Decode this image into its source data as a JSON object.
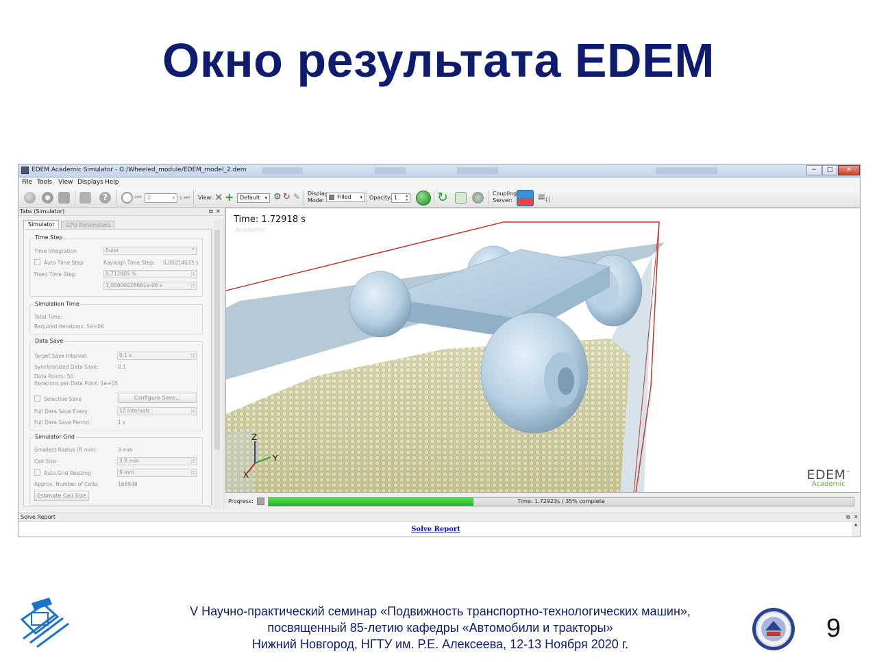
{
  "slide": {
    "title": "Окно результата EDEM",
    "footer_line1": "V Научно-практический семинар «Подвижность транспортно-технологических машин»,",
    "footer_line2": "посвященный 85-летию кафедры «Автомобили и тракторы»",
    "footer_line3": "Нижний Новгород, НГТУ им. Р.Е. Алексеева, 12-13 Ноября 2020 г.",
    "page_number": "9",
    "accent_color": "#0d1c6e"
  },
  "window": {
    "title": "EDEM Academic Simulator - G:/Wheeled_module/EDEM_model_2.dem",
    "controls": {
      "minimize": "−",
      "maximize": "□",
      "close": "✕"
    }
  },
  "menu": [
    "File",
    "Tools",
    "View",
    "Displays",
    "Help"
  ],
  "toolbar": {
    "step_value": "0",
    "step_unit": "s",
    "view_label": "View:",
    "view_value": "Default",
    "display_label_1": "Display",
    "display_label_2": "Mode:",
    "display_value": "Filled",
    "opacity_label": "Opacity:",
    "opacity_value": "1",
    "coupling_label_1": "Coupling",
    "coupling_label_2": "Server:",
    "icons": [
      "particle-icon",
      "reel-icon",
      "disk-icon",
      "save-icon",
      "help-icon",
      "timer-icon",
      "rewind-icon",
      "fast-forward-icon",
      "axes-icon",
      "add-icon",
      "gear-icon",
      "reset-icon",
      "brush-icon",
      "cube-icon",
      "spheres-icon",
      "refresh-icon",
      "sync-icon",
      "settings-icon",
      "coupling-icon",
      "wifi-icon"
    ]
  },
  "panel": {
    "header": "Tabs (Simulator)",
    "tabs": [
      "Simulator",
      "GPU Parameters"
    ],
    "time_step": {
      "title": "Time Step",
      "time_integration_label": "Time Integration",
      "time_integration_value": "Euler",
      "auto_time_step_label": "Auto Time Step",
      "rayleigh_label": "Rayleigh Time Step:",
      "rayleigh_value": "0.00014033 s",
      "fixed_label": "Fixed Time Step:",
      "fixed_percent": "0,712605 %",
      "fixed_seconds": "1,00000028661e-06 s"
    },
    "simulation_time": {
      "title": "Simulation Time",
      "total_label": "Total Time:",
      "required_iterations": "Required Iterations: 5e+06"
    },
    "data_save": {
      "title": "Data Save",
      "target_label": "Target Save Interval:",
      "target_value": "0,1 s",
      "sync_label": "Synchronized Data Save:",
      "sync_value": "0.1",
      "points": "Data Points: 50",
      "iterations_per_point": "Iterations per Data Point: 1e+05",
      "selective_label": "Selective Save",
      "configure_button": "Configure Save...",
      "full_every_label": "Full Data Save Every:",
      "full_every_value": "10 intervals",
      "full_period_label": "Full Data Save Period:",
      "full_period_value": "1 s"
    },
    "simulator_grid": {
      "title": "Simulator Grid",
      "smallest_label": "Smallest Radius (R min):",
      "smallest_value": "3 mm",
      "cell_label": "Cell Size:",
      "cell_value": "3 R min",
      "auto_grid_label": "Auto Grid Resizing",
      "auto_grid_value": "9 mm",
      "approx_label": "Approx. Number of Cells:",
      "approx_value": "168948",
      "estimate_button": "Estimate Cell Size"
    }
  },
  "viewport": {
    "time_text": "Time: 1.72918 s",
    "ghost_text": "Academic",
    "axis_z": "Z",
    "axis_y": "Y",
    "axis_x": "X",
    "brand": "EDEM",
    "brand_tm": "™",
    "brand_sub": "Academic"
  },
  "progress": {
    "label": "Progress:",
    "fraction": 0.35,
    "text": "Time: 1.72923s / 35% complete"
  },
  "solve_report": {
    "header": "Solve Report",
    "link": "Solve Report"
  }
}
